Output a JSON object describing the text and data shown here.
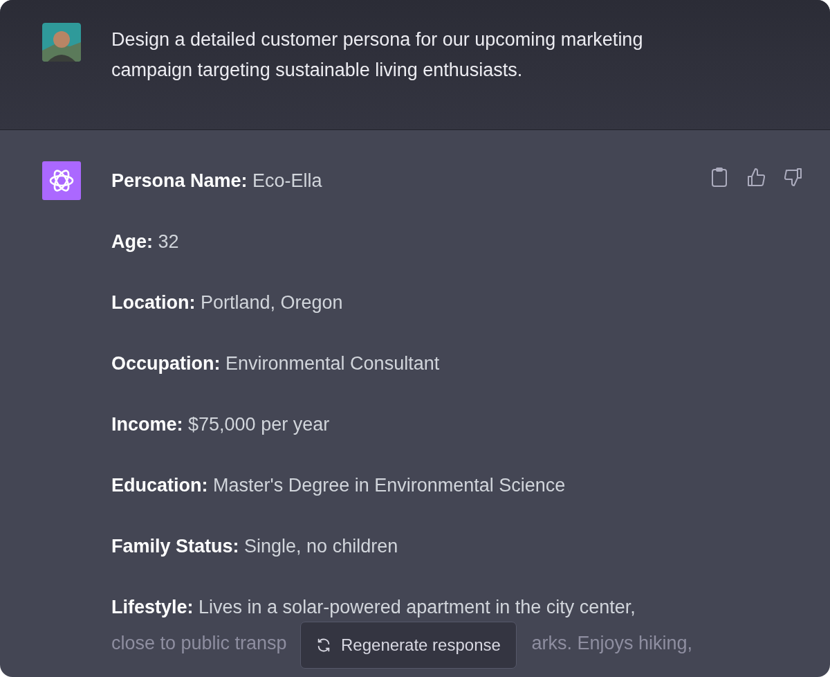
{
  "user_message": {
    "text": "Design a detailed customer persona for our upcoming marketing campaign targeting sustainable living enthusiasts."
  },
  "assistant_message": {
    "fields": [
      {
        "text": "**Persona Name:** Eco-Ella"
      },
      {
        "text": "**Age:** 32"
      },
      {
        "text": "**Location:** Portland, Oregon"
      },
      {
        "text": "**Occupation:** Environmental Consultant"
      },
      {
        "text": "**Income:** $75,000 per year"
      },
      {
        "text": "**Education:** Master's Degree in Environmental Science"
      },
      {
        "text": "**Family Status:** Single, no children"
      }
    ],
    "lifestyle": {
      "first_line": "**Lifestyle:** Lives in a solar-powered apartment in the city center,",
      "second_line_start": "close to public transp",
      "second_line_end": "arks. Enjoys hiking,"
    }
  },
  "regenerate_button": {
    "label": "Regenerate response"
  }
}
